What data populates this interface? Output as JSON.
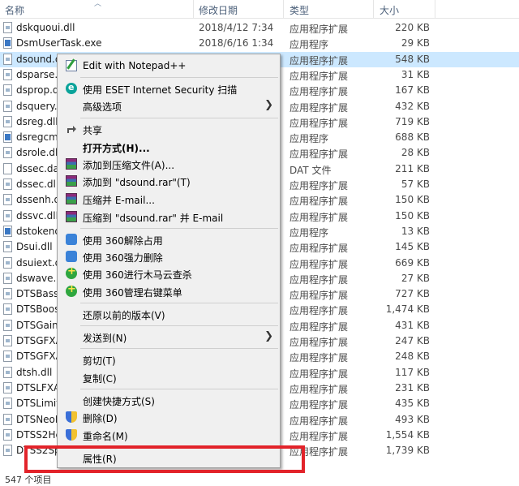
{
  "header": {
    "name": "名称",
    "date": "修改日期",
    "type": "类型",
    "size": "大小"
  },
  "files": [
    {
      "name": "dskquoui.dll",
      "date": "2018/4/12 7:34",
      "type": "应用程序扩展",
      "size": "220 KB",
      "icon": "dll-icon"
    },
    {
      "name": "DsmUserTask.exe",
      "date": "2018/6/16 1:34",
      "type": "应用程序",
      "size": "29 KB",
      "icon": "exe-icon"
    },
    {
      "name": "dsound.d",
      "date": "",
      "type": "应用程序扩展",
      "size": "548 KB",
      "icon": "dll-icon"
    },
    {
      "name": "dsparse.c",
      "date": "",
      "type": "应用程序扩展",
      "size": "31 KB",
      "icon": "dll-icon"
    },
    {
      "name": "dsprop.dl",
      "date": "",
      "type": "应用程序扩展",
      "size": "167 KB",
      "icon": "dll-icon"
    },
    {
      "name": "dsquery.d",
      "date": "",
      "type": "应用程序扩展",
      "size": "432 KB",
      "icon": "dll-icon"
    },
    {
      "name": "dsreg.dll",
      "date": "",
      "type": "应用程序扩展",
      "size": "719 KB",
      "icon": "dll-icon"
    },
    {
      "name": "dsregcm",
      "date": "",
      "type": "应用程序",
      "size": "688 KB",
      "icon": "exe-icon"
    },
    {
      "name": "dsrole.dll",
      "date": "",
      "type": "应用程序扩展",
      "size": "28 KB",
      "icon": "dll-icon"
    },
    {
      "name": "dssec.dat",
      "date": "",
      "type": "DAT 文件",
      "size": "211 KB",
      "icon": "dat-icon"
    },
    {
      "name": "dssec.dll",
      "date": "",
      "type": "应用程序扩展",
      "size": "57 KB",
      "icon": "dll-icon"
    },
    {
      "name": "dssenh.dl",
      "date": "",
      "type": "应用程序扩展",
      "size": "150 KB",
      "icon": "dll-icon"
    },
    {
      "name": "dssvc.dll",
      "date": "",
      "type": "应用程序扩展",
      "size": "150 KB",
      "icon": "dll-icon"
    },
    {
      "name": "dstokend",
      "date": "",
      "type": "应用程序",
      "size": "13 KB",
      "icon": "exe-icon"
    },
    {
      "name": "Dsui.dll",
      "date": "",
      "type": "应用程序扩展",
      "size": "145 KB",
      "icon": "dll-icon"
    },
    {
      "name": "dsuiext.d",
      "date": "",
      "type": "应用程序扩展",
      "size": "669 KB",
      "icon": "dll-icon"
    },
    {
      "name": "dswave.d",
      "date": "",
      "type": "应用程序扩展",
      "size": "27 KB",
      "icon": "dll-icon"
    },
    {
      "name": "DTSBassl",
      "date": "",
      "type": "应用程序扩展",
      "size": "727 KB",
      "icon": "dll-icon"
    },
    {
      "name": "DTSBoos",
      "date": "",
      "type": "应用程序扩展",
      "size": "1,474 KB",
      "icon": "dll-icon"
    },
    {
      "name": "DTSGainC",
      "date": "",
      "type": "应用程序扩展",
      "size": "431 KB",
      "icon": "dll-icon"
    },
    {
      "name": "DTSGFXA",
      "date": "",
      "type": "应用程序扩展",
      "size": "247 KB",
      "icon": "dll-icon"
    },
    {
      "name": "DTSGFXA",
      "date": "",
      "type": "应用程序扩展",
      "size": "248 KB",
      "icon": "dll-icon"
    },
    {
      "name": "dtsh.dll",
      "date": "",
      "type": "应用程序扩展",
      "size": "117 KB",
      "icon": "dll-icon"
    },
    {
      "name": "DTSLFXA",
      "date": "",
      "type": "应用程序扩展",
      "size": "231 KB",
      "icon": "dll-icon"
    },
    {
      "name": "DTSLimite",
      "date": "",
      "type": "应用程序扩展",
      "size": "435 KB",
      "icon": "dll-icon"
    },
    {
      "name": "DTSNeoF",
      "date": "",
      "type": "应用程序扩展",
      "size": "493 KB",
      "icon": "dll-icon"
    },
    {
      "name": "DTSS2He",
      "date": "",
      "type": "应用程序扩展",
      "size": "1,554 KB",
      "icon": "dll-icon"
    },
    {
      "name": "DTSS2Sp",
      "date": "",
      "type": "应用程序扩展",
      "size": "1,739 KB",
      "icon": "dll-icon"
    }
  ],
  "status": {
    "text": "547 个项目"
  },
  "menu": {
    "notepad": "Edit with Notepad++",
    "eset": "使用 ESET Internet Security 扫描",
    "advanced": "高级选项",
    "share": "共享",
    "open_with": "打开方式(H)...",
    "rar_add": "添加到压缩文件(A)...",
    "rar_add_named": "添加到 \"dsound.rar\"(T)",
    "rar_email": "压缩并 E-mail...",
    "rar_email_named": "压缩到 \"dsound.rar\" 并 E-mail",
    "s360_unlock": "使用 360解除占用",
    "s360_delete": "使用 360强力删除",
    "s360_scan": "使用 360进行木马云查杀",
    "s360_menu": "使用 360管理右键菜单",
    "restore": "还原以前的版本(V)",
    "send_to": "发送到(N)",
    "cut": "剪切(T)",
    "copy": "复制(C)",
    "shortcut": "创建快捷方式(S)",
    "delete": "删除(D)",
    "rename": "重命名(M)",
    "properties": "属性(R)"
  },
  "colors": {
    "selection": "#cce8ff",
    "highlight_box": "#e2232a"
  }
}
